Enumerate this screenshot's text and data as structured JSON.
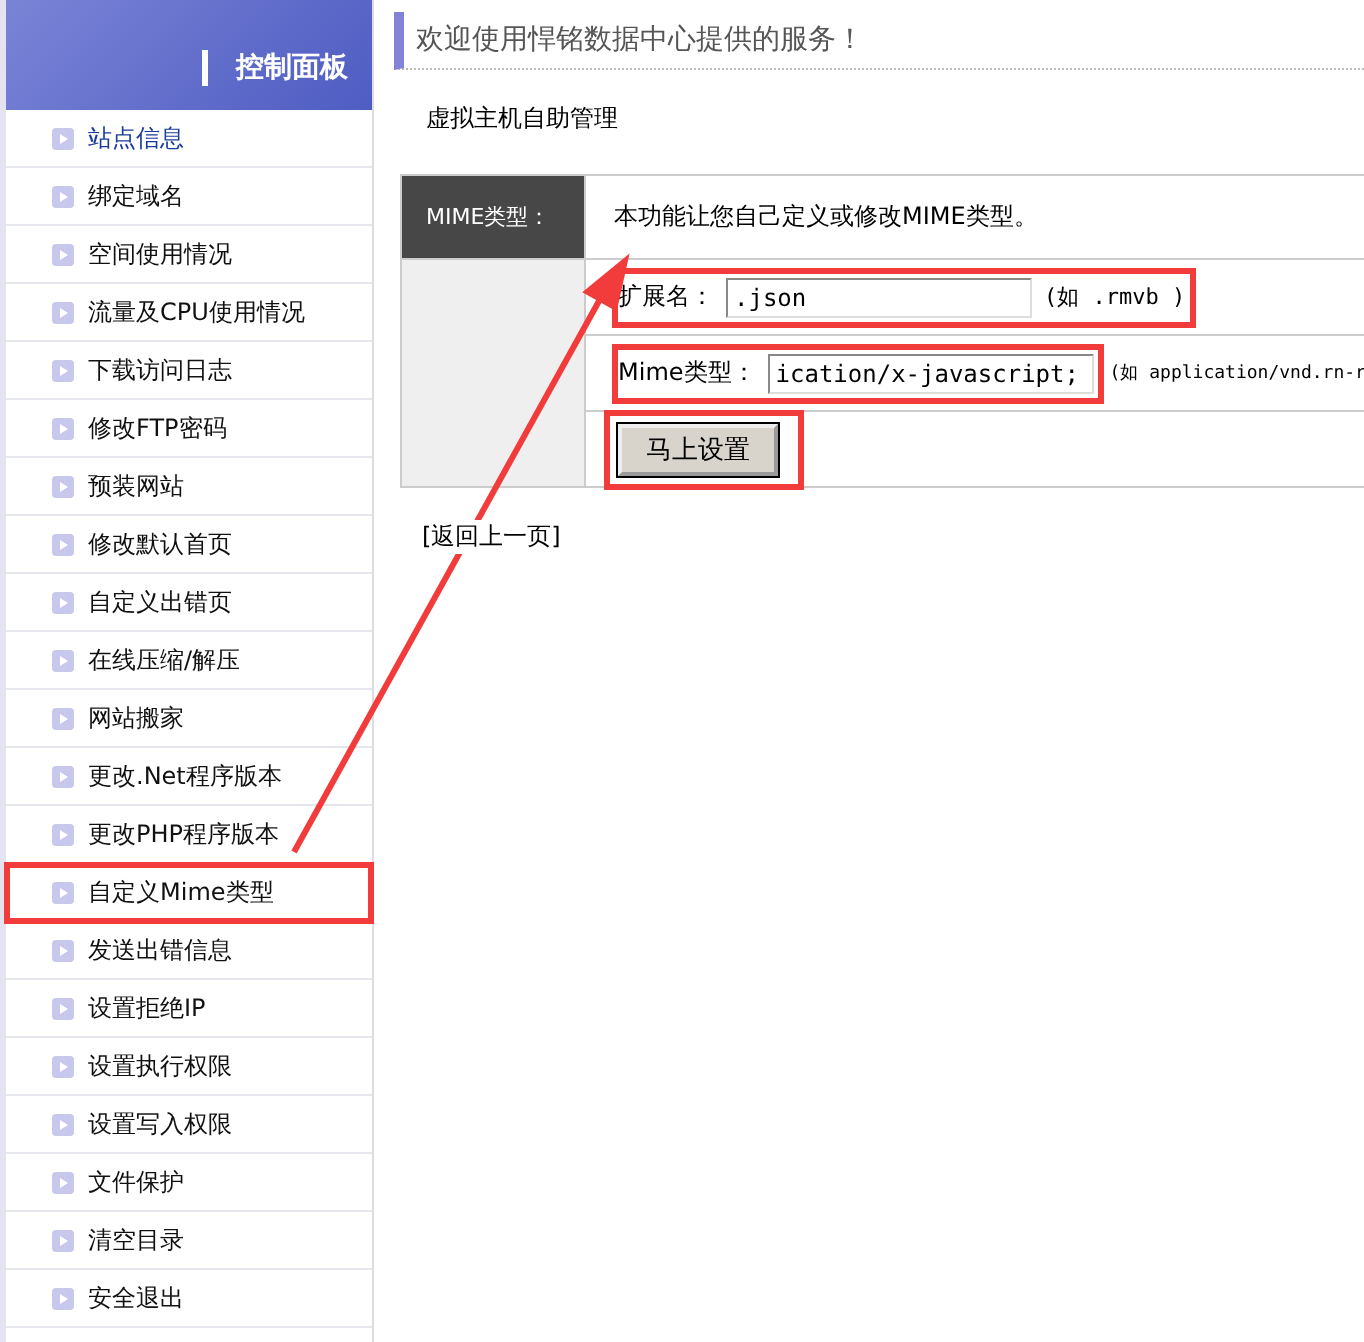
{
  "sidebar": {
    "title": "控制面板",
    "items": [
      {
        "label": "站点信息",
        "selected": true,
        "annotated": false
      },
      {
        "label": "绑定域名",
        "selected": false,
        "annotated": false
      },
      {
        "label": "空间使用情况",
        "selected": false,
        "annotated": false
      },
      {
        "label": "流量及CPU使用情况",
        "selected": false,
        "annotated": false
      },
      {
        "label": "下载访问日志",
        "selected": false,
        "annotated": false
      },
      {
        "label": "修改FTP密码",
        "selected": false,
        "annotated": false
      },
      {
        "label": "预装网站",
        "selected": false,
        "annotated": false
      },
      {
        "label": "修改默认首页",
        "selected": false,
        "annotated": false
      },
      {
        "label": "自定义出错页",
        "selected": false,
        "annotated": false
      },
      {
        "label": "在线压缩/解压",
        "selected": false,
        "annotated": false
      },
      {
        "label": "网站搬家",
        "selected": false,
        "annotated": false
      },
      {
        "label": "更改.Net程序版本",
        "selected": false,
        "annotated": false
      },
      {
        "label": "更改PHP程序版本",
        "selected": false,
        "annotated": false
      },
      {
        "label": "自定义Mime类型",
        "selected": false,
        "annotated": true
      },
      {
        "label": "发送出错信息",
        "selected": false,
        "annotated": false
      },
      {
        "label": "设置拒绝IP",
        "selected": false,
        "annotated": false
      },
      {
        "label": "设置执行权限",
        "selected": false,
        "annotated": false
      },
      {
        "label": "设置写入权限",
        "selected": false,
        "annotated": false
      },
      {
        "label": "文件保护",
        "selected": false,
        "annotated": false
      },
      {
        "label": "清空目录",
        "selected": false,
        "annotated": false
      },
      {
        "label": "安全退出",
        "selected": false,
        "annotated": false
      }
    ]
  },
  "header": {
    "title": "欢迎使用悍铭数据中心提供的服务！"
  },
  "section_title": "虚拟主机自助管理",
  "form": {
    "heading": "MIME类型：",
    "description": "本功能让您自己定义或修改MIME类型。",
    "fields": [
      {
        "label": "扩展名：",
        "value": ".json",
        "hint": "(如 .rmvb )",
        "annotated": true
      },
      {
        "label": "Mime类型：",
        "value": "ication/x-javascript;",
        "hint": "(如 application/vnd.rn-r",
        "annotated": true
      }
    ],
    "submit": {
      "label": "马上设置",
      "annotated": true
    }
  },
  "back_link": "[返回上一页]"
}
